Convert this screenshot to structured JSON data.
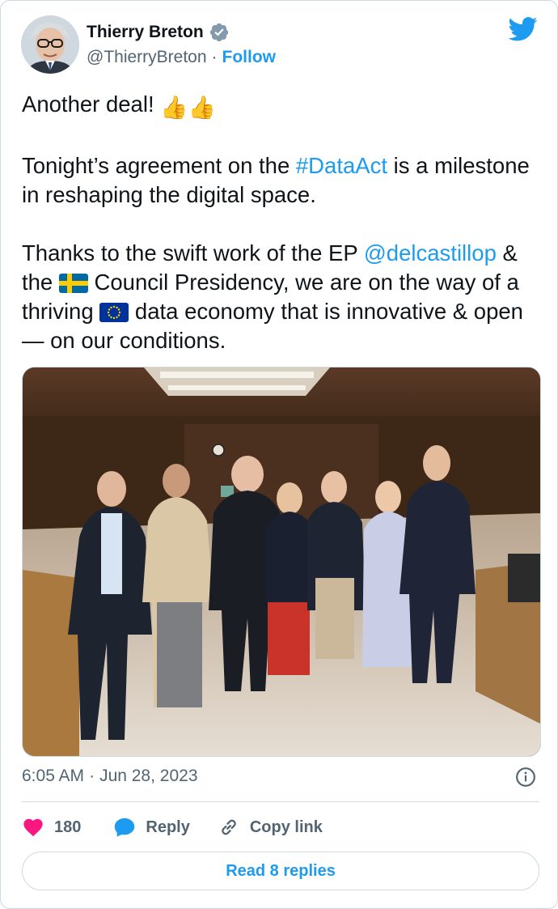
{
  "author": {
    "display_name": "Thierry Breton",
    "handle": "@ThierryBreton",
    "separator": "·",
    "follow_label": "Follow",
    "verified_icon": "verified-badge-icon",
    "avatar_icon": "avatar"
  },
  "brand": {
    "logo_icon": "twitter-bird-icon",
    "accent": "#1d9bf0"
  },
  "tweet": {
    "line1_text": "Another deal!",
    "line1_emoji": "👍👍",
    "p2_before": "Tonight’s agreement on the ",
    "p2_hashtag": "#DataAct",
    "p2_after": " is a milestone in reshaping the digital space.",
    "p3_before": "Thanks to the swift work of the EP ",
    "p3_mention": "@delcastillop",
    "p3_mid1": " & the ",
    "p3_flag1": "swedish-flag-icon",
    "p3_mid2": " Council Presidency, we are on the way of a thriving ",
    "p3_flag2": "eu-flag-icon",
    "p3_after": " data economy that is innovative & open — on our conditions."
  },
  "media": {
    "type": "photo",
    "icon": "photo-image"
  },
  "meta": {
    "time": "6:05 AM",
    "separator": "·",
    "date": "Jun 28, 2023",
    "info_icon": "info-icon"
  },
  "actions": {
    "like_count": "180",
    "reply_label": "Reply",
    "copy_link_label": "Copy link",
    "like_color": "#f91880"
  },
  "footer": {
    "read_replies_label": "Read 8 replies"
  }
}
